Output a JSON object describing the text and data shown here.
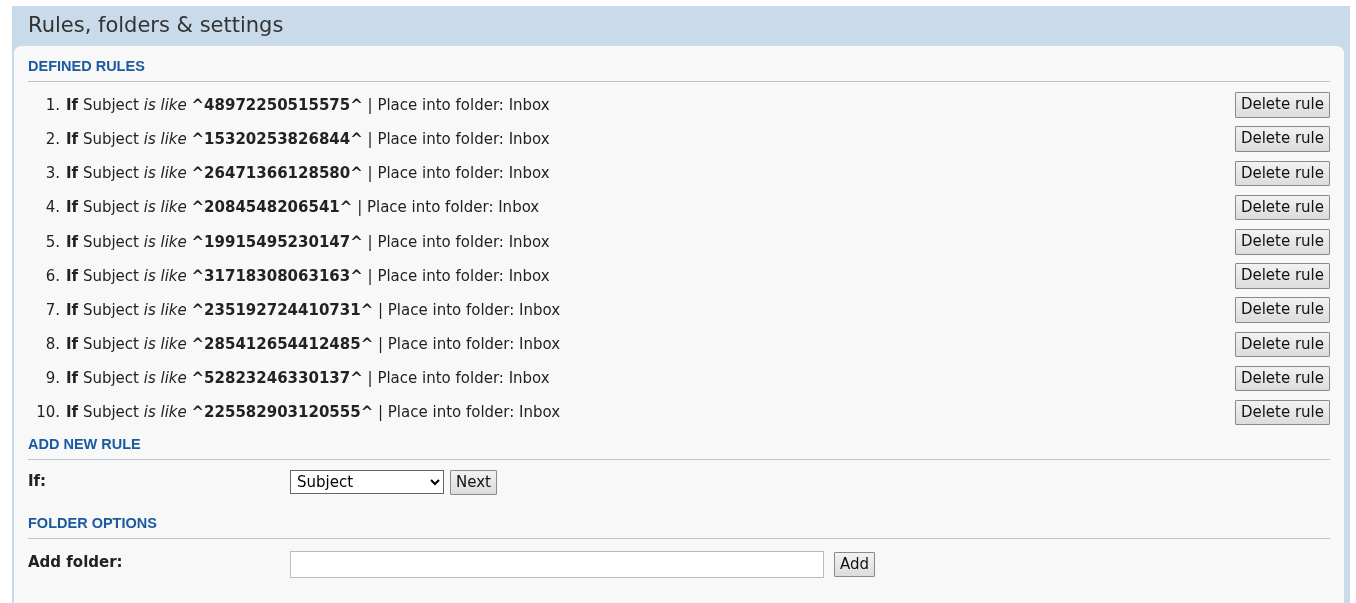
{
  "page_title": "Rules, folders & settings",
  "defined_rules": {
    "heading": "DEFINED RULES",
    "rules": [
      {
        "number": "1.",
        "text": "**If** Subject *is like* **^48972250515575^** | Place into folder: Inbox",
        "button": "Delete rule"
      },
      {
        "number": "2.",
        "text": "**If** Subject *is like* **^15320253826844^** | Place into folder: Inbox",
        "button": "Delete rule"
      },
      {
        "number": "3.",
        "text": "**If** Subject *is like* **^26471366128580^** | Place into folder: Inbox",
        "button": "Delete rule"
      },
      {
        "number": "4.",
        "text": "**If** Subject *is like* **^2084548206541^** | Place into folder: Inbox",
        "button": "Delete rule"
      },
      {
        "number": "5.",
        "text": "**If** Subject *is like* **^19915495230147^** | Place into folder: Inbox",
        "button": "Delete rule"
      },
      {
        "number": "6.",
        "text": "**If** Subject *is like* **^31718308063163^** | Place into folder: Inbox",
        "button": "Delete rule"
      },
      {
        "number": "7.",
        "text": "**If** Subject *is like* **^235192724410731^** | Place into folder: Inbox",
        "button": "Delete rule"
      },
      {
        "number": "8.",
        "text": "**If** Subject *is like* **^285412654412485^** | Place into folder: Inbox",
        "button": "Delete rule"
      },
      {
        "number": "9.",
        "text": "**If** Subject *is like* **^52823246330137^** | Place into folder: Inbox",
        "button": "Delete rule"
      },
      {
        "number": "10.",
        "text": "**If** Subject *is like* **^225582903120555^** | Place into folder: Inbox",
        "button": "Delete rule"
      }
    ]
  },
  "add_new_rule": {
    "heading": "ADD NEW RULE",
    "label": "If:",
    "select_value": "Subject",
    "button": "Next"
  },
  "folder_options": {
    "heading": "FOLDER OPTIONS",
    "label": "Add folder:",
    "button": "Add"
  }
}
